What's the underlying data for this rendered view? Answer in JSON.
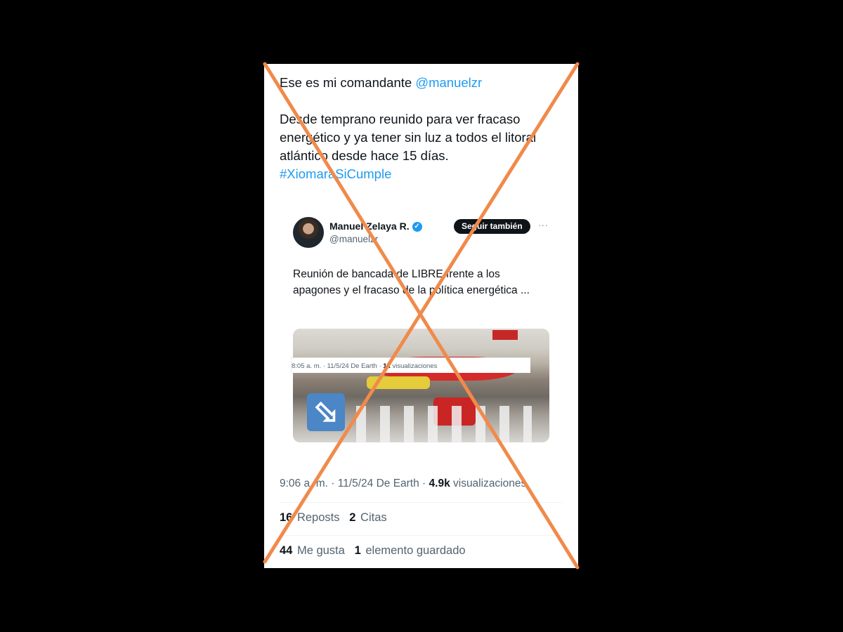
{
  "tweet": {
    "line1_text": "Ese es mi comandante ",
    "mention": "@manuelzr",
    "body": "Desde temprano reunido para ver fracaso energético y ya tener sin luz a todos el litoral atlántico desde hace 15 días.",
    "hashtag": "#XiomaraSiCumple"
  },
  "quoted": {
    "name": "Manuel Zelaya R.",
    "verified_icon": "✓",
    "handle": "@manuelzr",
    "follow_label": "Seguir también",
    "more_icon": "···",
    "text": "Reunión de bancada de LIBRE frente a los apagones y el fracaso  de la política energética ...",
    "meta_time": "8:05 a. m. · 11/5/24 De Earth · ",
    "meta_views_count": "1k",
    "meta_views_label": " visualizaciones",
    "photo_arrow_icon": "⬂"
  },
  "meta": {
    "time": "9:06 a. m. · 11/5/24 De Earth · ",
    "views_count": "4.9k",
    "views_label": " visualizaciones"
  },
  "stats": {
    "reposts_count": "16",
    "reposts_label": " Reposts",
    "quotes_count": "2",
    "quotes_label": " Citas",
    "likes_count": "44",
    "likes_label": " Me gusta",
    "saved_count": "1",
    "saved_label": " elemento guardado"
  },
  "colors": {
    "background": "#000000",
    "link": "#1d9bf0",
    "cross": "#f08a4b"
  }
}
